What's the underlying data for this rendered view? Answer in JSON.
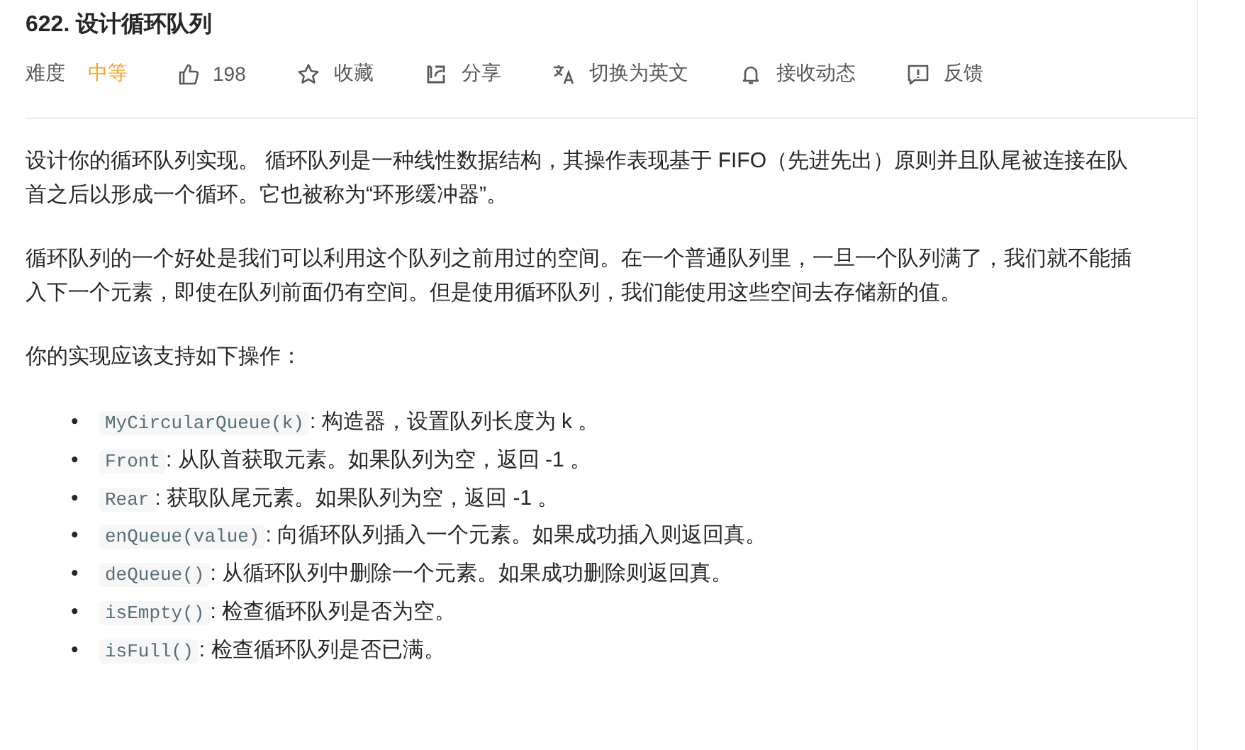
{
  "title": "622. 设计循环队列",
  "difficulty": {
    "label": "难度",
    "value": "中等",
    "kind": "medium"
  },
  "actions": [
    {
      "kind": "like",
      "label": "198"
    },
    {
      "kind": "star",
      "label": "收藏"
    },
    {
      "kind": "share",
      "label": "分享"
    },
    {
      "kind": "translate",
      "label": "切换为英文"
    },
    {
      "kind": "bell",
      "label": "接收动态"
    },
    {
      "kind": "feedback",
      "label": "反馈"
    }
  ],
  "paragraphs": [
    "设计你的循环队列实现。 循环队列是一种线性数据结构，其操作表现基于 FIFO（先进先出）原则并且队尾被连接在队首之后以形成一个循环。它也被称为“环形缓冲器”。",
    "循环队列的一个好处是我们可以利用这个队列之前用过的空间。在一个普通队列里，一旦一个队列满了，我们就不能插入下一个元素，即使在队列前面仍有空间。但是使用循环队列，我们能使用这些空间去存储新的值。",
    "你的实现应该支持如下操作："
  ],
  "operations": [
    {
      "bullet": "•",
      "code": "MyCircularQueue(k)",
      "text": ": 构造器，设置队列长度为 k 。"
    },
    {
      "bullet": "•",
      "code": "Front",
      "text": ": 从队首获取元素。如果队列为空，返回 -1 。"
    },
    {
      "bullet": "•",
      "code": "Rear",
      "text": ": 获取队尾元素。如果队列为空，返回 -1 。"
    },
    {
      "bullet": "•",
      "code": "enQueue(value)",
      "text": ": 向循环队列插入一个元素。如果成功插入则返回真。"
    },
    {
      "bullet": "•",
      "code": "deQueue()",
      "text": ": 从循环队列中删除一个元素。如果成功删除则返回真。"
    },
    {
      "bullet": "•",
      "code": "isEmpty()",
      "text": ": 检查循环队列是否为空。"
    },
    {
      "bullet": "•",
      "code": "isFull()",
      "text": ": 检查循环队列是否已满。"
    }
  ]
}
